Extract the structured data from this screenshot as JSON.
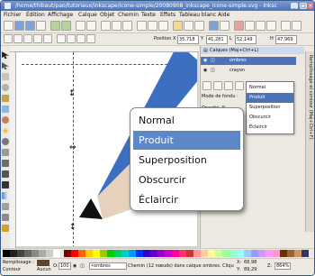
{
  "window": {
    "title": "/home/thibaut/pao/tutoriaux/inkscape/icone-simple/20080908_inkscape_icone-simple.svg - Inksc"
  },
  "menubar": [
    "Fichier",
    "Édition",
    "Affichage",
    "Calque",
    "Objet",
    "Chemin",
    "Texte",
    "Effets",
    "Tableau blanc",
    "Aide"
  ],
  "coords": {
    "x_label": "Position X",
    "x_value": "35,718",
    "y_label": "Y",
    "y_value": "41,281",
    "w_label": "L",
    "w_value": "52,149",
    "h_label": "H",
    "h_value": "47,969"
  },
  "layers_panel": {
    "header": "Calques (Maj+Ctrl+L)",
    "layers": [
      {
        "name": "ombres",
        "selected": true
      },
      {
        "name": "crayon",
        "selected": false
      }
    ],
    "mode_label": "Mode de fondu :",
    "opacity_label": "Opacité, %"
  },
  "dock_tab_label": "Remplissage et contour (Maj+Ctrl+F)",
  "blend_dropdown_small": {
    "options": [
      "Normal",
      "Produit",
      "Superposition",
      "Obscurcir",
      "Éclaircir"
    ],
    "selected_index": 1
  },
  "blend_popup": {
    "options": [
      "Normal",
      "Produit",
      "Superposition",
      "Obscurcir",
      "Éclaircir"
    ],
    "selected_index": 1
  },
  "statusbar": {
    "fill_label": "Remplissage :",
    "stroke_label": "Contour",
    "stroke_value": "Aucun",
    "opacity_label": "O:",
    "opacity_value": "100",
    "layer_label": "•ombres",
    "message": "Chemin (12 nœuds) dans calque ombres. Cliqu",
    "x_label": "X:",
    "x_value": "68,98",
    "y_label": "Y:",
    "y_value": "89,29",
    "zoom_label": "Z:",
    "zoom_value": "864%"
  },
  "colors": {
    "titlebar": "#4c72b8",
    "selection": "#5d87c7",
    "pencil_blue": "#3d6fc0",
    "wood": "#e6d2bc"
  }
}
